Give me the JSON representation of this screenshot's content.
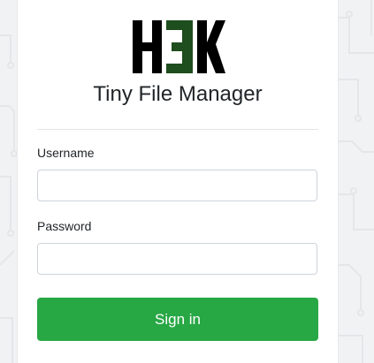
{
  "app": {
    "logo_text": "H3K",
    "title": "Tiny File Manager"
  },
  "form": {
    "username": {
      "label": "Username",
      "value": "",
      "placeholder": ""
    },
    "password": {
      "label": "Password",
      "value": "",
      "placeholder": ""
    },
    "submit_label": "Sign in"
  },
  "colors": {
    "accent": "#28a745",
    "logo_dark": "#000000",
    "logo_green": "#1e4d1e",
    "background": "#f1f2f3"
  }
}
